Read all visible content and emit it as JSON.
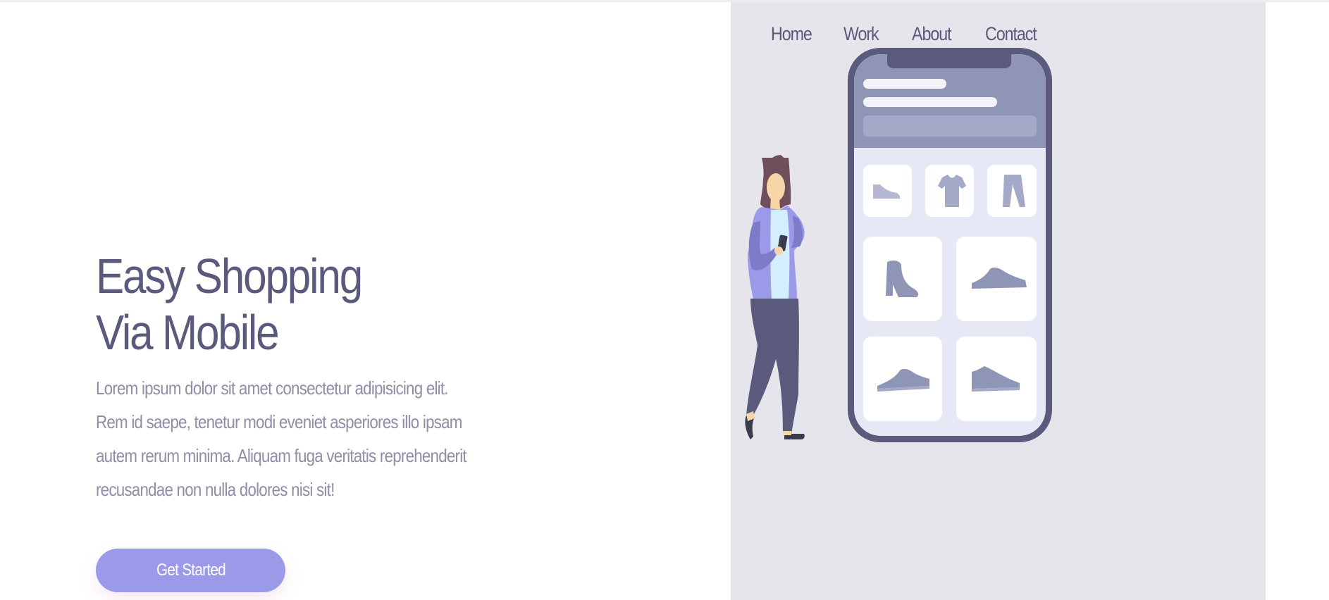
{
  "nav": {
    "items": [
      "Home",
      "Work",
      "About",
      "Contact"
    ]
  },
  "hero": {
    "title_line1": "Easy Shopping",
    "title_line2": "Via Mobile",
    "description": "Lorem ipsum dolor sit amet consectetur adipisicing elit. Rem id saepe, tenetur modi eveniet asperiores illo ipsam autem rerum minima. Aliquam fuga veritatis reprehenderit recusandae non nulla dolores nisi sit!",
    "cta_label": "Get Started"
  },
  "colors": {
    "text_primary": "#5a5a7d",
    "text_muted": "#8e8ea6",
    "accent": "#9b9ae8",
    "panel_bg": "#e6e5eb",
    "phone_frame": "#5a5a7d"
  },
  "illustration": {
    "icons": [
      "person-icon",
      "phone-icon",
      "shoe-icon",
      "tshirt-icon",
      "pants-icon",
      "boot-icon",
      "sneaker-icon"
    ]
  }
}
